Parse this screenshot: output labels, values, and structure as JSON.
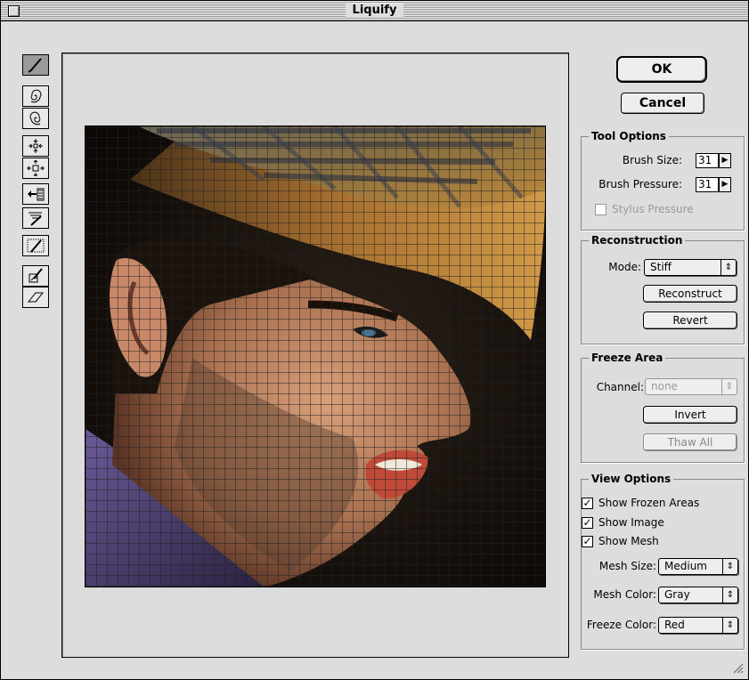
{
  "window": {
    "title": "Liquify"
  },
  "tools": [
    {
      "name": "warp-tool",
      "selected": true
    },
    {
      "name": "twirl-clockwise-tool"
    },
    {
      "name": "twirl-counterclockwise-tool"
    },
    {
      "name": "pucker-tool"
    },
    {
      "name": "bloat-tool"
    },
    {
      "name": "shift-pixels-tool"
    },
    {
      "name": "reflection-tool"
    },
    {
      "name": "reconstruct-tool"
    },
    {
      "name": "freeze-tool"
    },
    {
      "name": "thaw-tool"
    }
  ],
  "buttons": {
    "ok": "OK",
    "cancel": "Cancel"
  },
  "tool_options": {
    "title": "Tool Options",
    "brush_size_label": "Brush Size:",
    "brush_size_value": "31",
    "brush_pressure_label": "Brush Pressure:",
    "brush_pressure_value": "31",
    "stylus_pressure_label": "Stylus Pressure",
    "stylus_pressure_checked": false
  },
  "reconstruction": {
    "title": "Reconstruction",
    "mode_label": "Mode:",
    "mode_value": "Stiff",
    "reconstruct_label": "Reconstruct",
    "revert_label": "Revert"
  },
  "freeze_area": {
    "title": "Freeze Area",
    "channel_label": "Channel:",
    "channel_value": "none",
    "invert_label": "Invert",
    "thaw_all_label": "Thaw All"
  },
  "view_options": {
    "title": "View Options",
    "show_frozen_areas_label": "Show Frozen Areas",
    "show_frozen_areas_checked": true,
    "show_image_label": "Show Image",
    "show_image_checked": true,
    "show_mesh_label": "Show Mesh",
    "show_mesh_checked": true,
    "mesh_size_label": "Mesh Size:",
    "mesh_size_value": "Medium",
    "mesh_color_label": "Mesh Color:",
    "mesh_color_value": "Gray",
    "freeze_color_label": "Freeze Color:",
    "freeze_color_value": "Red"
  },
  "glyphs": {
    "check": "✓",
    "popup_arrows": "⇕",
    "right_arrow": "▶"
  },
  "colors": {
    "dialog_bg": "#dddddd",
    "mesh": "#222222",
    "selected_tool": "#9a9a9a"
  }
}
